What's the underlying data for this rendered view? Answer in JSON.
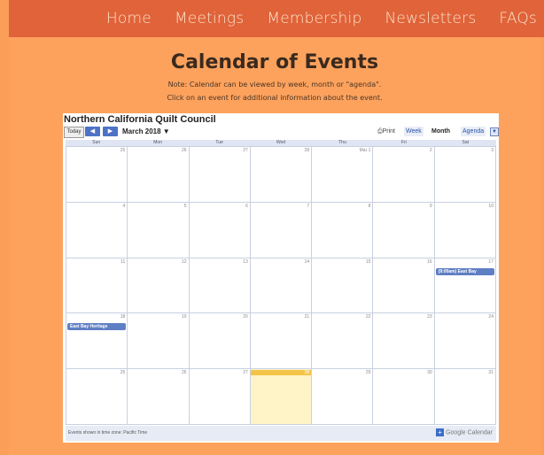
{
  "nav": {
    "items": [
      "Home",
      "Meetings",
      "Membership",
      "Newsletters",
      "FAQs"
    ]
  },
  "heading": "Calendar of Events",
  "notes": [
    "Note: Calendar can be viewed by week, month or \"agenda\".",
    "Click on an event for additional information about the event."
  ],
  "calendar": {
    "title": "Northern California Quilt Council",
    "today_label": "Today",
    "prev_label": "◀",
    "next_label": "▶",
    "month_label": "March 2018 ▼",
    "print_label": "Print",
    "tabs": {
      "week": "Week",
      "month": "Month",
      "agenda": "Agenda"
    },
    "collapse_icon": "▼",
    "weekdays": [
      "Sun",
      "Mon",
      "Tue",
      "Wed",
      "Thu",
      "Fri",
      "Sat"
    ],
    "weeks": [
      [
        "25",
        "26",
        "27",
        "28",
        "Mar 1",
        "2",
        "3"
      ],
      [
        "4",
        "5",
        "6",
        "7",
        "8",
        "9",
        "10"
      ],
      [
        "11",
        "12",
        "13",
        "14",
        "15",
        "16",
        "17"
      ],
      [
        "18",
        "19",
        "20",
        "21",
        "22",
        "23",
        "24"
      ],
      [
        "25",
        "26",
        "27",
        "28",
        "29",
        "30",
        "31"
      ]
    ],
    "today": {
      "week": 4,
      "day": 3
    },
    "events": [
      {
        "week": 2,
        "day": 6,
        "label": "(9:00am) East Bay"
      },
      {
        "week": 3,
        "day": 0,
        "label": "East Bay Heritage"
      }
    ],
    "footer_tz": "Events shown in time zone: Pacific Time",
    "google_label": "Google Calendar",
    "colors": {
      "event": "#5f7fc4",
      "today": "#fff4c8",
      "nav": "#e0633a",
      "page": "#fda25d"
    }
  }
}
